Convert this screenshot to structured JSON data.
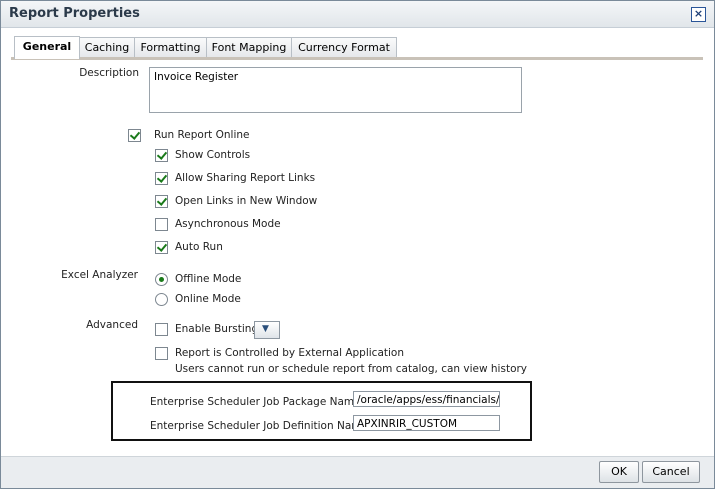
{
  "dialog": {
    "title": "Report Properties",
    "close_label": "×"
  },
  "tabs": [
    {
      "label": "General",
      "active": true
    },
    {
      "label": "Caching"
    },
    {
      "label": "Formatting"
    },
    {
      "label": "Font Mapping"
    },
    {
      "label": "Currency Format"
    }
  ],
  "general": {
    "description_label": "Description",
    "description_value": "Invoice Register",
    "run_report_online": {
      "label": "Run Report Online",
      "checked": true
    },
    "show_controls": {
      "label": "Show Controls",
      "checked": true
    },
    "allow_sharing": {
      "label": "Allow Sharing Report Links",
      "checked": true
    },
    "open_links_new_window": {
      "label": "Open Links in New Window",
      "checked": true
    },
    "asynchronous_mode": {
      "label": "Asynchronous Mode",
      "checked": false
    },
    "auto_run": {
      "label": "Auto Run",
      "checked": true
    },
    "excel_analyzer_label": "Excel Analyzer",
    "offline_mode": {
      "label": "Offline Mode",
      "selected": true
    },
    "online_mode": {
      "label": "Online Mode",
      "selected": false
    },
    "advanced_label": "Advanced",
    "enable_bursting": {
      "label": "Enable Bursting",
      "checked": false
    },
    "external_control": {
      "label": "Report is Controlled by External Application",
      "hint": "Users cannot run or schedule report from catalog, can view history",
      "checked": false
    },
    "package_name_label": "Enterprise Scheduler Job Package Name",
    "package_name_value": "/oracle/apps/ess/financials/pa",
    "definition_name_label": "Enterprise Scheduler Job Definition Name",
    "definition_name_value": "APXINRIR_CUSTOM"
  },
  "buttons": {
    "ok": "OK",
    "cancel": "Cancel"
  },
  "icons": {
    "close": "close-icon",
    "dropdown": "chevron-down-icon"
  }
}
